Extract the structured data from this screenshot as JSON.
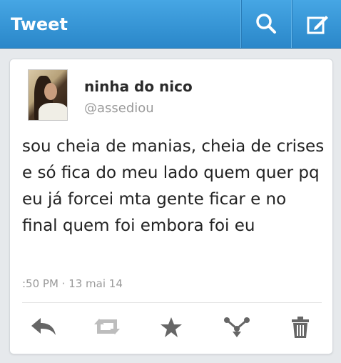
{
  "header": {
    "title": "Tweet",
    "background": "#2f8fd0",
    "icons": [
      "search-icon",
      "compose-icon"
    ]
  },
  "tweet": {
    "user_name": "ninha do nico",
    "handle": "@assediou",
    "text": "sou cheia de manias, cheia de crises e só fica do meu lado quem quer pq eu já forcei mta gente ficar e no final quem foi embora foi eu",
    "timestamp": ":50 PM · 13 mai 14"
  },
  "actions": [
    "reply-icon",
    "retweet-icon",
    "favorite-icon",
    "share-icon",
    "delete-icon"
  ],
  "colors": {
    "icon_gray": "#666666",
    "retweet_disabled": "#bdbdbd"
  }
}
